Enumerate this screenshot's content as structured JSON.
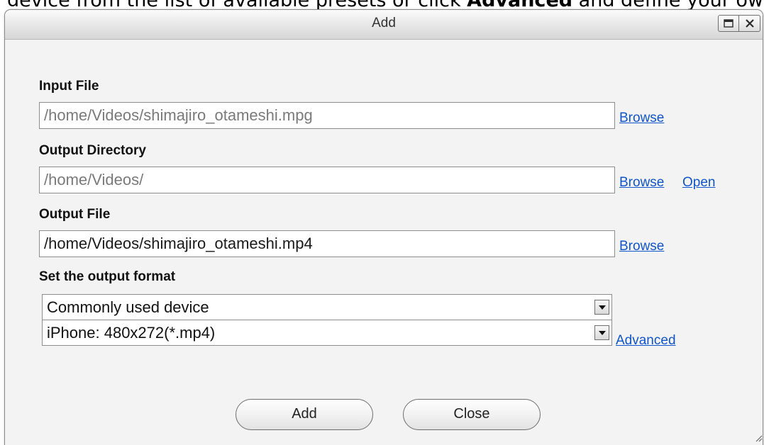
{
  "backdrop": {
    "line_prefix": "device from the list of available presets or click ",
    "line_bold": "Advanced",
    "line_suffix": " and define your own"
  },
  "dialog": {
    "title": "Add",
    "window_buttons": {
      "maximize_icon": "maximize-icon",
      "close_icon": "close-icon"
    }
  },
  "input_file": {
    "label": "Input File",
    "value": "/home/Videos/shimajiro_otameshi.mpg",
    "browse_label": "Browse"
  },
  "output_directory": {
    "label": "Output Directory",
    "value": "/home/Videos/",
    "browse_label": "Browse",
    "open_label": "Open"
  },
  "output_file": {
    "label": "Output File",
    "value": "/home/Videos/shimajiro_otameshi.mp4",
    "browse_label": "Browse"
  },
  "output_format": {
    "label": "Set the output format",
    "category_selected": "Commonly used device",
    "preset_selected": "iPhone: 480x272(*.mp4)",
    "advanced_label": "Advanced"
  },
  "buttons": {
    "add_label": "Add",
    "close_label": "Close"
  },
  "colors": {
    "link": "#1155cc",
    "dialog_bg": "#f3f3f3",
    "readonly_text": "#7a7a7a"
  }
}
